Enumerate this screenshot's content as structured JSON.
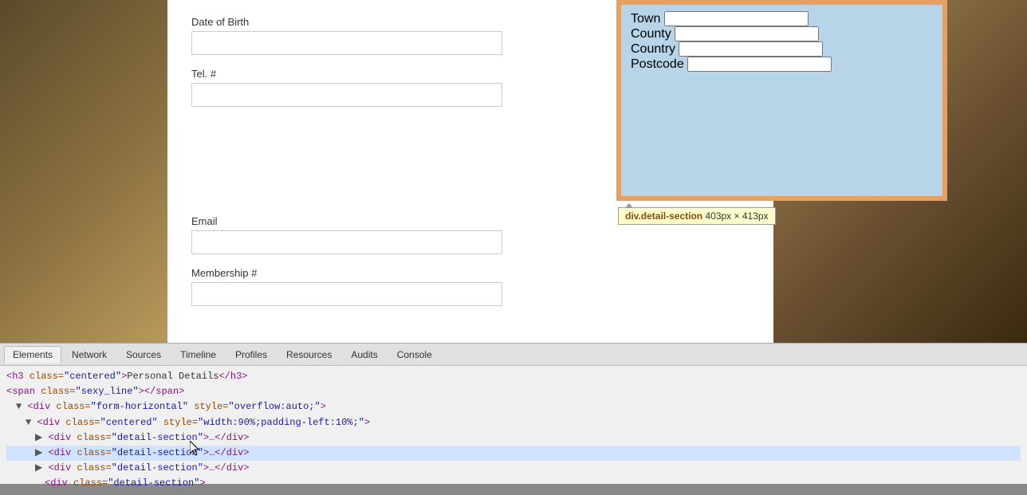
{
  "background": {
    "color": "#7a6030"
  },
  "form": {
    "fields": [
      {
        "label": "Date of Birth",
        "id": "dob",
        "value": ""
      },
      {
        "label": "Tel. #",
        "id": "tel",
        "value": ""
      },
      {
        "label": "Email",
        "id": "email",
        "value": ""
      },
      {
        "label": "Membership #",
        "id": "membership",
        "value": ""
      }
    ]
  },
  "address_panel": {
    "fields": [
      {
        "label": "Town",
        "id": "town",
        "value": ""
      },
      {
        "label": "County",
        "id": "county",
        "value": ""
      },
      {
        "label": "Country",
        "id": "country",
        "value": ""
      },
      {
        "label": "Postcode",
        "id": "postcode",
        "value": ""
      }
    ]
  },
  "tooltip": {
    "text": "div.detail-section",
    "dimensions": "403px × 413px"
  },
  "devtools": {
    "tabs": [
      {
        "label": "Elements",
        "active": true
      },
      {
        "label": "Network",
        "active": false
      },
      {
        "label": "Sources",
        "active": false
      },
      {
        "label": "Timeline",
        "active": false
      },
      {
        "label": "Profiles",
        "active": false
      },
      {
        "label": "Resources",
        "active": false
      },
      {
        "label": "Audits",
        "active": false
      },
      {
        "label": "Console",
        "active": false
      }
    ],
    "code_lines": [
      {
        "indent": 0,
        "content": "<h3 class=\"centered\">Personal Details</h3>",
        "selected": false
      },
      {
        "indent": 0,
        "content": "<span class=\"sexy_line\"></span>",
        "selected": false
      },
      {
        "indent": 0,
        "content": "<div class=\"form-horizontal\" style=\"overflow:auto;\">",
        "selected": false,
        "open": true
      },
      {
        "indent": 1,
        "content": "<div class=\"centered\" style=\"width:90%;padding-left:10%;\">",
        "selected": false,
        "open": true
      },
      {
        "indent": 2,
        "content": "<div class=\"detail-section\">...</div>",
        "selected": false,
        "open": false
      },
      {
        "indent": 2,
        "content": "<div class=\"detail-section\">...</div>",
        "selected": true,
        "open": false
      },
      {
        "indent": 2,
        "content": "<div class=\"detail-section\">...</div>",
        "selected": false,
        "open": false
      },
      {
        "indent": 2,
        "content": "<div class=\"detail-section\">",
        "selected": false,
        "open": false,
        "partial": true
      }
    ]
  }
}
